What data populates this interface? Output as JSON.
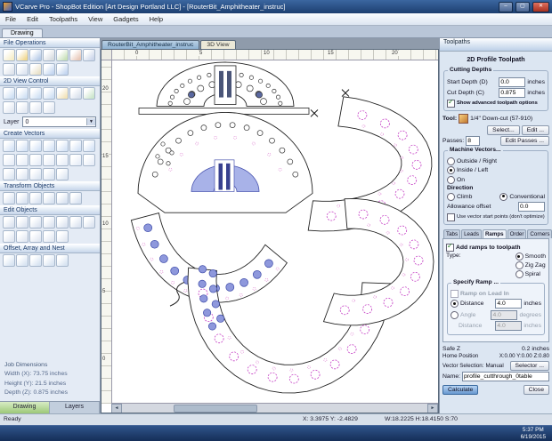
{
  "window": {
    "title": "VCarve Pro - ShopBot Edition [Art Design Portland LLC] - [RouterBit_Amphitheater_instruc]",
    "menu_items": [
      "File",
      "Edit",
      "Toolpaths",
      "View",
      "Gadgets",
      "Help"
    ],
    "app_tab": "Drawing",
    "controls": {
      "minimize": "–",
      "maximize": "▢",
      "close": "✕"
    }
  },
  "left_panel": {
    "sections": {
      "file_operations": {
        "title": "File Operations",
        "rows": [
          [
            {
              "name": "new-file",
              "c": "#f6edc8"
            },
            {
              "name": "open-file",
              "c": "#f0d890"
            },
            {
              "name": "save-file",
              "c": "#b8cce8"
            },
            {
              "name": "print",
              "c": "#d8dce0"
            },
            {
              "name": "import-vectors",
              "c": "#c8e0b8"
            },
            {
              "name": "export-vectors",
              "c": "#e8c8b8"
            },
            {
              "name": "job-setup",
              "c": "#ccd6ea"
            }
          ],
          [
            {
              "name": "cut",
              "c": "#dfe4ec"
            },
            {
              "name": "copy",
              "c": "#dce4f0"
            },
            {
              "name": "paste",
              "c": "#e8e0c8"
            },
            {
              "name": "undo",
              "c": "#c4d6f0"
            },
            {
              "name": "redo",
              "c": "#c4d6f0"
            }
          ]
        ]
      },
      "view_control": {
        "title": "2D View Control",
        "rows": [
          [
            {
              "name": "zoom-in",
              "c": "#cfe0f4"
            },
            {
              "name": "zoom-out",
              "c": "#cfe0f4"
            },
            {
              "name": "zoom-window",
              "c": "#cfe0f4"
            },
            {
              "name": "zoom-extents",
              "c": "#cfe0f4"
            },
            {
              "name": "pan-view",
              "c": "#f2e2b8"
            },
            {
              "name": "previous-view",
              "c": "#d8e0ec"
            },
            {
              "name": "refresh-view",
              "c": "#cde6cd"
            }
          ],
          [
            {
              "name": "snap-grid-toggle",
              "c": "#e2e8f2"
            },
            {
              "name": "guides-toggle",
              "c": "#e2e8f2"
            },
            {
              "name": "ruler-toggle",
              "c": "#e2e8f2"
            },
            {
              "name": "switch-3d-view",
              "c": "#e2e8f2"
            }
          ]
        ]
      },
      "layer": {
        "label": "Layer",
        "value": "0"
      },
      "create_vectors": {
        "title": "Create Vectors",
        "rows": [
          [
            {
              "name": "draw-circle",
              "c": "#d6e4f6"
            },
            {
              "name": "draw-ellipse",
              "c": "#d6e4f6"
            },
            {
              "name": "draw-rectangle",
              "c": "#d6e4f6"
            },
            {
              "name": "draw-polygon",
              "c": "#d6e4f6"
            },
            {
              "name": "draw-star",
              "c": "#d6e4f6"
            },
            {
              "name": "draw-polyline",
              "c": "#d6e4f6"
            },
            {
              "name": "draw-bezier-curve",
              "c": "#d6e4f6"
            }
          ],
          [
            {
              "name": "draw-text",
              "c": "#e8eef8"
            },
            {
              "name": "text-on-curve",
              "c": "#e8eef8"
            },
            {
              "name": "dimensioning",
              "c": "#e8eef8"
            },
            {
              "name": "draw-arc",
              "c": "#e8eef8"
            },
            {
              "name": "trace-bitmap",
              "c": "#e8eef8"
            },
            {
              "name": "insert-symbol",
              "c": "#e8eef8"
            },
            {
              "name": "fit-curve",
              "c": "#e8eef8"
            }
          ],
          [
            {
              "name": "convert-to-curves",
              "c": "#dde6f2"
            },
            {
              "name": "extend-line",
              "c": "#dde6f2"
            },
            {
              "name": "measure-tool",
              "c": "#dde6f2"
            },
            {
              "name": "snap-settings",
              "c": "#dde6f2"
            },
            {
              "name": "draw-gear",
              "c": "#dde6f2"
            }
          ]
        ]
      },
      "transform": {
        "title": "Transform Objects",
        "rows": [
          [
            {
              "name": "move-selection",
              "c": "#d8e2f0"
            },
            {
              "name": "rotate-selection",
              "c": "#d8e2f0"
            },
            {
              "name": "scale-selection",
              "c": "#d8e2f0"
            },
            {
              "name": "mirror-selection",
              "c": "#d8e2f0"
            },
            {
              "name": "align-objects",
              "c": "#d8e2f0"
            },
            {
              "name": "distribute-objects",
              "c": "#d8e2f0"
            }
          ]
        ]
      },
      "edit_objects": {
        "title": "Edit Objects",
        "rows": [
          [
            {
              "name": "node-editing",
              "c": "#dce4f0"
            },
            {
              "name": "measure",
              "c": "#dce4f0"
            },
            {
              "name": "trim-vectors",
              "c": "#dce4f0"
            },
            {
              "name": "extend-vectors",
              "c": "#dce4f0"
            },
            {
              "name": "fillet-corners",
              "c": "#dce4f0"
            },
            {
              "name": "join-vectors",
              "c": "#dce4f0"
            },
            {
              "name": "close-vector",
              "c": "#dce4f0"
            }
          ],
          [
            {
              "name": "weld-vectors",
              "c": "#e2e8f2"
            },
            {
              "name": "subtract-vectors",
              "c": "#e2e8f2"
            },
            {
              "name": "trim-overlap",
              "c": "#e2e8f2"
            },
            {
              "name": "array-copy",
              "c": "#e2e8f2"
            },
            {
              "name": "nest-objects",
              "c": "#e2e8f2"
            }
          ]
        ]
      },
      "offset_nest": {
        "title": "Offset, Array and Nest",
        "rows": [
          [
            {
              "name": "offset-vectors",
              "c": "#d8e4f2"
            },
            {
              "name": "inward-offset",
              "c": "#d8e4f2"
            },
            {
              "name": "linear-array",
              "c": "#d8e4f2"
            },
            {
              "name": "circular-array",
              "c": "#d8e4f2"
            },
            {
              "name": "nest-parts",
              "c": "#d8e4f2"
            }
          ]
        ]
      }
    },
    "job_dimensions": {
      "title": "Job Dimensions",
      "lines": [
        "Width (X): 73.75 inches",
        "Height (Y): 21.5 inches",
        "Depth (Z): 0.875 inches"
      ]
    },
    "bottom_tabs": [
      "Drawing",
      "Layers"
    ]
  },
  "canvas": {
    "doc_tabs": [
      "RouterBit_Amphitheater_instruc",
      "3D View"
    ],
    "ruler_top": [
      "0",
      "5",
      "10",
      "15",
      "20"
    ],
    "ruler_left": [
      "20",
      "15",
      "10",
      "5",
      "0"
    ]
  },
  "toolpaths": {
    "panel_title": "Toolpaths",
    "header": "2D Profile Toolpath",
    "cutting_depths": {
      "title": "Cutting Depths",
      "rows": [
        {
          "label": "Start Depth (D)",
          "value": "0.0",
          "unit": "inches"
        },
        {
          "label": "Cut Depth (C)",
          "value": "0.875",
          "unit": "inches"
        }
      ],
      "advanced_label": "Show advanced toolpath options"
    },
    "tool": {
      "label": "Tool:",
      "name": "1/4\" Down-cut (57-910)",
      "select_button": "Select...",
      "edit_button": "Edit ...",
      "passes_label": "Passes:",
      "passes_value": "8",
      "edit_passes_button": "Edit Passes ..."
    },
    "machine_vectors": {
      "title": "Machine Vectors...",
      "options": [
        {
          "label": "Outside / Right",
          "selected": false
        },
        {
          "label": "Inside / Left",
          "selected": true
        },
        {
          "label": "On",
          "selected": false
        }
      ],
      "direction_label": "Direction",
      "direction_options": [
        {
          "label": "Climb",
          "selected": false
        },
        {
          "label": "Conventional",
          "selected": true
        }
      ],
      "allowance_label": "Allowance offset",
      "allowance_value": "0.0",
      "start_points_label": "Use vector start points (don't optimize)"
    },
    "tabs": [
      {
        "label": "Tabs"
      },
      {
        "label": "Leads"
      },
      {
        "label": "Ramps",
        "active": true
      },
      {
        "label": "Order"
      },
      {
        "label": "Corners"
      }
    ],
    "ramps": {
      "add_label": "Add ramps to toolpath",
      "type_label": "Type:",
      "type_options": [
        {
          "label": "Smooth",
          "selected": true
        },
        {
          "label": "Zig Zag",
          "selected": false
        },
        {
          "label": "Spiral",
          "selected": false
        }
      ],
      "specify_title": "Specify Ramp ...",
      "lead_in_label": "Ramp on Lead In",
      "distance_label": "Distance",
      "distance_value": "4.0",
      "distance_unit": "inches",
      "angle_label": "Angle",
      "angle_value": "4.0",
      "angle_unit": "degrees",
      "distance2_label": "Distance",
      "distance2_value": "4.0",
      "distance2_unit": "inches"
    },
    "footer": {
      "safe_z_label": "Safe Z",
      "safe_z_value": "0.2 inches",
      "home_label": "Home Position",
      "home_value": "X:0.00 Y:0.00 Z:0.80",
      "vector_selection_label": "Vector Selection:",
      "vector_selection_value": "Manual",
      "selector_button": "Selector ...",
      "name_label": "Name:",
      "name_value": "profile_cutthrough_0table",
      "calculate_button": "Calculate",
      "close_button": "Close"
    }
  },
  "status_bar": {
    "ready": "Ready",
    "coords": "X: 3.3975 Y: -2.4829",
    "dims": "W:18.2225 H:18.4150 S:70"
  },
  "taskbar": {
    "time": "5:37 PM",
    "date": "6/19/2015"
  }
}
